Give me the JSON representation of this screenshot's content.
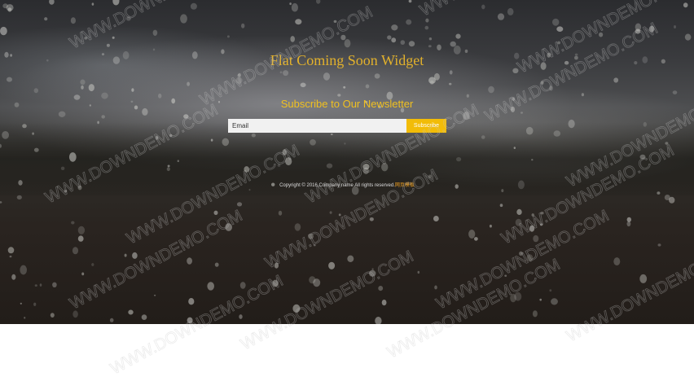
{
  "page": {
    "title": "Flat Coming Soon Widget",
    "newsletter_heading": "Subscribe to Our Newsletter",
    "email_placeholder": "Email",
    "subscribe_label": "Subscribe",
    "copyright_text": "Copyright © 2016.Company name All rights reserved.",
    "copyright_link": "网页模板"
  },
  "watermark": {
    "text": "WWW.DOWNDEMO.COM"
  },
  "colors": {
    "accent": "#f2bc08",
    "title": "#e2b12c",
    "input_bg": "#f1f1f1"
  }
}
